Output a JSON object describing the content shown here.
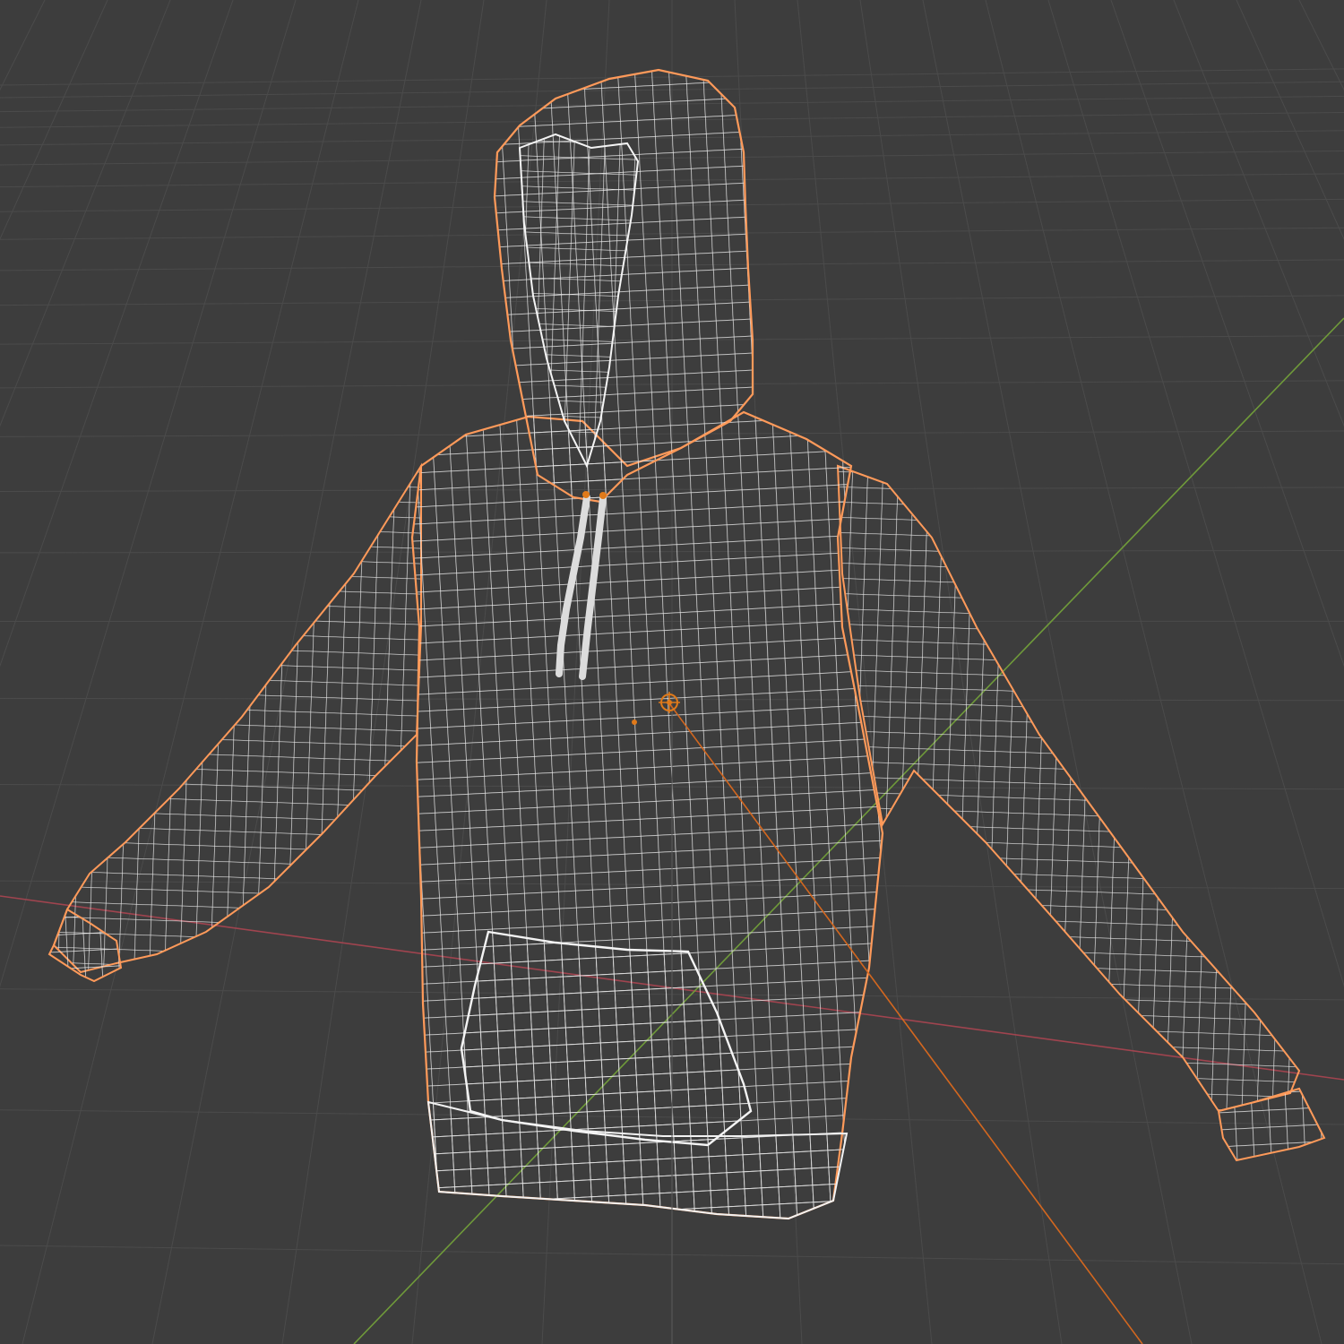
{
  "viewport": {
    "mode": "wireframe",
    "background_color": "#3d3d3d",
    "floor_grid_color": "#4b4b4b",
    "axis_colors": {
      "x": "#a0444f",
      "y": "#6f9a3a",
      "selection_line": "#d3671f"
    },
    "wire_color": "#e8e8e8",
    "selection_outline_color": "#ff9a5a",
    "origin_marker_color": "#e07a1a"
  },
  "object": {
    "name_visible": false,
    "type": "hoodie-mesh",
    "selected": true,
    "parts": [
      "hood",
      "drawstring-left",
      "drawstring-right",
      "torso",
      "kangaroo-pocket",
      "waistband",
      "left-sleeve",
      "left-cuff",
      "right-sleeve",
      "right-cuff"
    ]
  }
}
